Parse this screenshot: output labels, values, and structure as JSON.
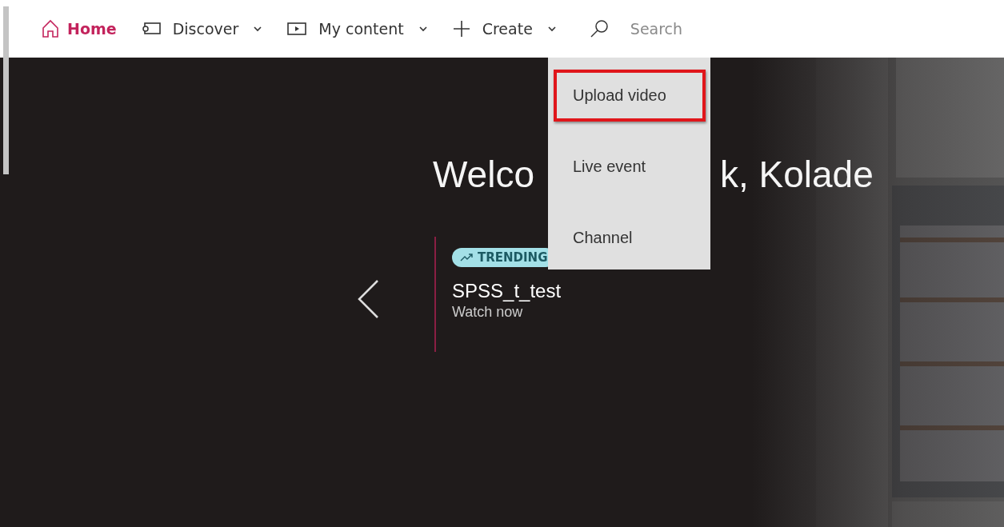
{
  "nav": {
    "items": [
      {
        "kind": "home",
        "label": "Home",
        "selected": true,
        "dropdown": false
      },
      {
        "kind": "discover",
        "label": "Discover",
        "selected": false,
        "dropdown": true
      },
      {
        "kind": "content",
        "label": "My content",
        "selected": false,
        "dropdown": true
      },
      {
        "kind": "create",
        "label": "Create",
        "selected": false,
        "dropdown": true
      }
    ],
    "search": {
      "placeholder": "Search"
    }
  },
  "create_menu": {
    "items": [
      {
        "label": "Upload video",
        "highlighted": true
      },
      {
        "label": "Live event",
        "highlighted": false
      },
      {
        "label": "Channel",
        "highlighted": false
      }
    ]
  },
  "welcome": {
    "before_menu": "Welco",
    "after_menu": "k, Kolade"
  },
  "hero": {
    "badge": "TRENDING",
    "title": "SPSS_t_test",
    "subtitle": "Watch now"
  }
}
